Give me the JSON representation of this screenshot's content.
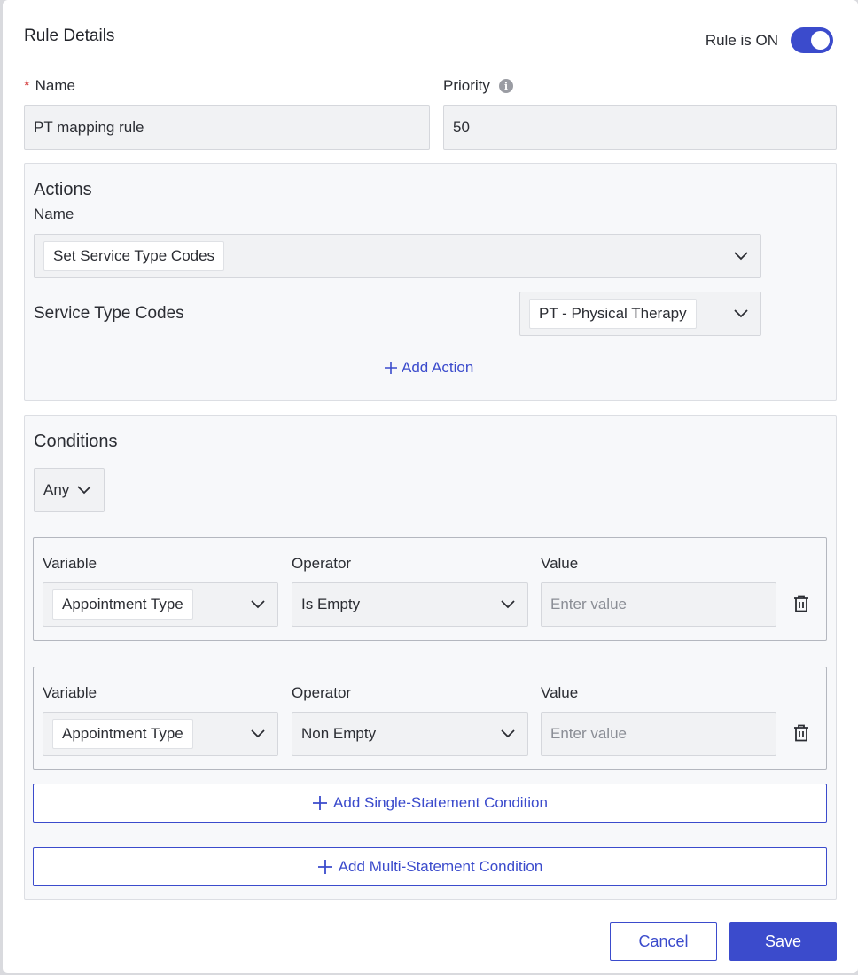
{
  "dialog": {
    "title": "Rule Details",
    "toggle_label": "Rule is ON",
    "toggle_on": true
  },
  "name_field": {
    "label": "Name",
    "required_mark": "*",
    "value": "PT mapping rule"
  },
  "priority_field": {
    "label": "Priority",
    "info_icon": "i",
    "value": "50"
  },
  "actions": {
    "title": "Actions",
    "name_label": "Name",
    "name_value": "Set Service Type Codes",
    "service_type_label": "Service Type Codes",
    "service_type_value": "PT - Physical Therapy",
    "add_action": "Add Action"
  },
  "conditions": {
    "title": "Conditions",
    "match_mode": "Any",
    "rows": [
      {
        "variable_label": "Variable",
        "operator_label": "Operator",
        "value_label": "Value",
        "variable": "Appointment Type",
        "operator": "Is Empty",
        "value_placeholder": "Enter value"
      },
      {
        "variable_label": "Variable",
        "operator_label": "Operator",
        "value_label": "Value",
        "variable": "Appointment Type",
        "operator": "Non Empty",
        "value_placeholder": "Enter value"
      }
    ],
    "add_single": "Add Single-Statement Condition",
    "add_multi": "Add Multi-Statement Condition"
  },
  "footer": {
    "cancel": "Cancel",
    "save": "Save"
  },
  "colors": {
    "accent": "#3b4bcc",
    "required": "#d33a3a"
  },
  "icons": [
    "info-icon",
    "chevron-down-icon",
    "plus-icon",
    "trash-icon"
  ]
}
